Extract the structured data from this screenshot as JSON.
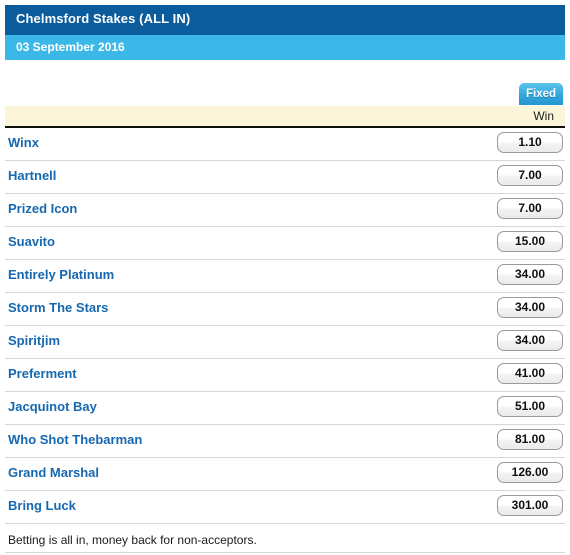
{
  "header": {
    "title": "Chelmsford Stakes (ALL IN)",
    "date": "03 September 2016",
    "title_bg": "#0b5c9c",
    "date_bg": "#3bb8e8"
  },
  "tabs": [
    {
      "label": "Fixed",
      "active": true,
      "color": "#2596cf"
    }
  ],
  "columns": {
    "win_label": "Win",
    "header_bg": "#fcf5d9"
  },
  "runners": [
    {
      "name": "Winx",
      "win": "1.10"
    },
    {
      "name": "Hartnell",
      "win": "7.00"
    },
    {
      "name": "Prized Icon",
      "win": "7.00"
    },
    {
      "name": "Suavito",
      "win": "15.00"
    },
    {
      "name": "Entirely Platinum",
      "win": "34.00"
    },
    {
      "name": "Storm The Stars",
      "win": "34.00"
    },
    {
      "name": "Spiritjim",
      "win": "34.00"
    },
    {
      "name": "Preferment",
      "win": "41.00"
    },
    {
      "name": "Jacquinot Bay",
      "win": "51.00"
    },
    {
      "name": "Who Shot Thebarman",
      "win": "81.00"
    },
    {
      "name": "Grand Marshal",
      "win": "126.00"
    },
    {
      "name": "Bring Luck",
      "win": "301.00"
    }
  ],
  "footer": {
    "note": "Betting is all in, money back for non-acceptors."
  },
  "theme": {
    "link_color": "#1668b0",
    "row_divider": "#d7d7d7"
  }
}
